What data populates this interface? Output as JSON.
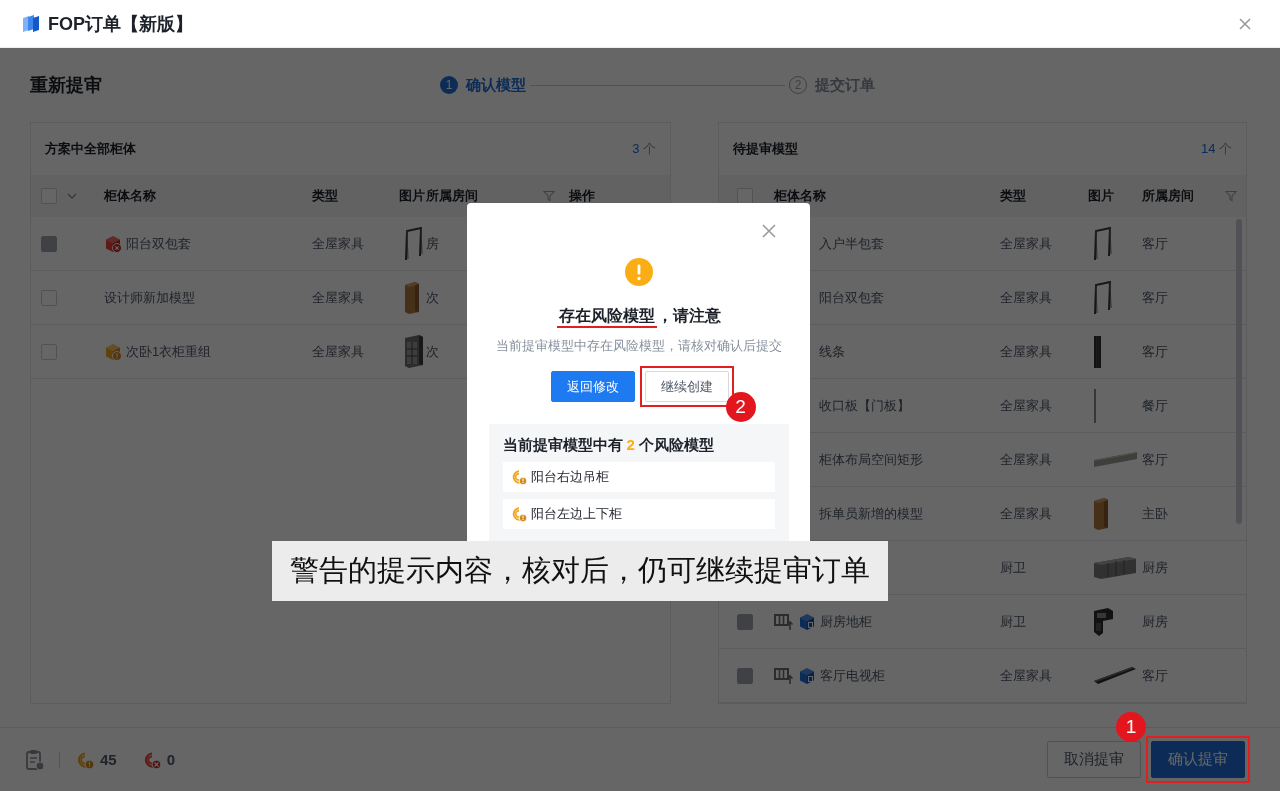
{
  "window": {
    "title": "FOP订单【新版】"
  },
  "page_title": "重新提审",
  "steps": [
    {
      "number": "1",
      "label": "确认模型",
      "selected": true
    },
    {
      "number": "2",
      "label": "提交订单",
      "selected": false
    }
  ],
  "panels": [
    {
      "title": "方案中全部柜体",
      "count": "3",
      "unit": "个",
      "select_all": {
        "checked": false,
        "dropdown": true
      },
      "columns": [
        {
          "label": "柜体名称",
          "filter": false
        },
        {
          "label": "类型",
          "filter": false
        },
        {
          "label": "图片",
          "filter": false
        },
        {
          "label": "所属房间",
          "filter": true
        },
        {
          "label": "操作",
          "filter": false
        }
      ],
      "rows": [
        {
          "disabled": true,
          "checked": false,
          "kind": "error",
          "name": "阳台双包套",
          "type": "全屋家具",
          "picture": {
            "kind": "frame"
          },
          "room": "房"
        },
        {
          "disabled": false,
          "checked": false,
          "kind": "plain",
          "name": "设计师新加模型",
          "type": "全屋家具",
          "picture": {
            "kind": "wood-cabinet"
          },
          "room": "次"
        },
        {
          "disabled": false,
          "checked": false,
          "kind": "warning",
          "name": "次卧1衣柜重组",
          "type": "全屋家具",
          "picture": {
            "kind": "gray-cabinet"
          },
          "room": "次"
        }
      ]
    },
    {
      "title": "待提审模型",
      "count": "14",
      "unit": "个",
      "select_all": {
        "checked": false,
        "dropdown": false
      },
      "columns": [
        {
          "label": "柜体名称",
          "filter": false
        },
        {
          "label": "类型",
          "filter": false
        },
        {
          "label": "图片",
          "filter": false
        },
        {
          "label": "所属房间",
          "filter": true
        }
      ],
      "rows": [
        {
          "kind": "plain",
          "name": "入户半包套",
          "type": "全屋家具",
          "picture": {
            "kind": "frame"
          },
          "room": "客厅"
        },
        {
          "kind": "plain",
          "name": "阳台双包套",
          "type": "全屋家具",
          "picture": {
            "kind": "frame"
          },
          "room": "客厅"
        },
        {
          "kind": "plain",
          "name": "线条",
          "type": "全屋家具",
          "picture": {
            "kind": "bar"
          },
          "room": "客厅"
        },
        {
          "kind": "plain",
          "name": "收口板【门板】",
          "type": "全屋家具",
          "picture": {
            "kind": "thin-line"
          },
          "room": "餐厅"
        },
        {
          "kind": "plain",
          "name": "柜体布局空间矩形",
          "type": "全屋家具",
          "picture": {
            "kind": "slab"
          },
          "room": "客厅"
        },
        {
          "kind": "plain",
          "name": "拆单员新增的模型",
          "type": "全屋家具",
          "picture": {
            "kind": "wood-cabinet"
          },
          "room": "主卧"
        },
        {
          "kind": "plain",
          "type": "厨卫",
          "picture": {
            "kind": "drawer-row"
          },
          "room": "厨房"
        },
        {
          "disabled": true,
          "checked": false,
          "split": true,
          "kind": "model",
          "name": "厨房地柜",
          "type": "厨卫",
          "picture": {
            "kind": "corner-unit"
          },
          "room": "厨房"
        },
        {
          "disabled": true,
          "checked": false,
          "split": true,
          "kind": "model",
          "name": "客厅电视柜",
          "type": "全屋家具",
          "picture": {
            "kind": "tv-bar"
          },
          "room": "客厅"
        }
      ]
    }
  ],
  "footer": {
    "stats": [
      {
        "kind": "warning",
        "value": "45"
      },
      {
        "kind": "error",
        "value": "0"
      }
    ],
    "buttons": [
      {
        "label": "取消提审",
        "kind": "default",
        "highlighted": false
      },
      {
        "label": "确认提审",
        "kind": "primary",
        "highlighted": true,
        "marker": "1"
      }
    ]
  },
  "dialog": {
    "title_emphasis": "存在风险模型",
    "title_rest": "，请注意",
    "message": "当前提审模型中存在风险模型，请核对确认后提交",
    "buttons": [
      {
        "label": "返回修改",
        "kind": "primary",
        "highlighted": false
      },
      {
        "label": "继续创建",
        "kind": "default",
        "highlighted": true,
        "marker": "2"
      }
    ],
    "summary": {
      "prefix": "当前提审模型中有",
      "count": "2",
      "suffix": "个风险模型"
    },
    "risk_items": [
      "阳台右边吊柜",
      "阳台左边上下柜"
    ]
  },
  "caption": "警告的提示内容，核对后，仍可继续提审订单"
}
